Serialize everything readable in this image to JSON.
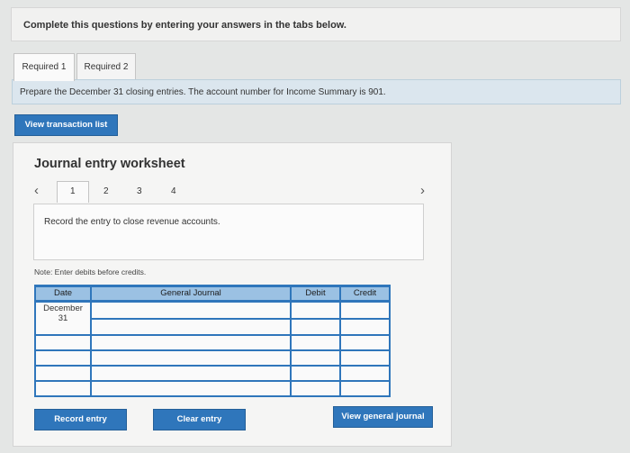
{
  "instructions": "Complete this questions by entering your answers in the tabs below.",
  "tabs": [
    {
      "label": "Required 1"
    },
    {
      "label": "Required 2"
    }
  ],
  "prompt": "Prepare the December 31 closing entries. The account number for Income Summary is 901.",
  "view_transaction_label": "View transaction list",
  "worksheet": {
    "title": "Journal entry worksheet",
    "pages": [
      "1",
      "2",
      "3",
      "4"
    ],
    "prev_icon": "chevron-left-icon",
    "next_icon": "chevron-right-icon",
    "entry_prompt": "Record the entry to close revenue accounts.",
    "note": "Note: Enter debits before credits.",
    "columns": {
      "date": "Date",
      "journal": "General Journal",
      "debit": "Debit",
      "credit": "Credit"
    },
    "rows": [
      {
        "date_month": "December",
        "date_day": "31"
      }
    ]
  },
  "buttons": {
    "record": "Record entry",
    "clear": "Clear entry",
    "view_general": "View general journal"
  },
  "colors": {
    "accent": "#2f76bb",
    "header_fill": "#9bc1e3",
    "prompt_bar": "#dbe6ee"
  }
}
